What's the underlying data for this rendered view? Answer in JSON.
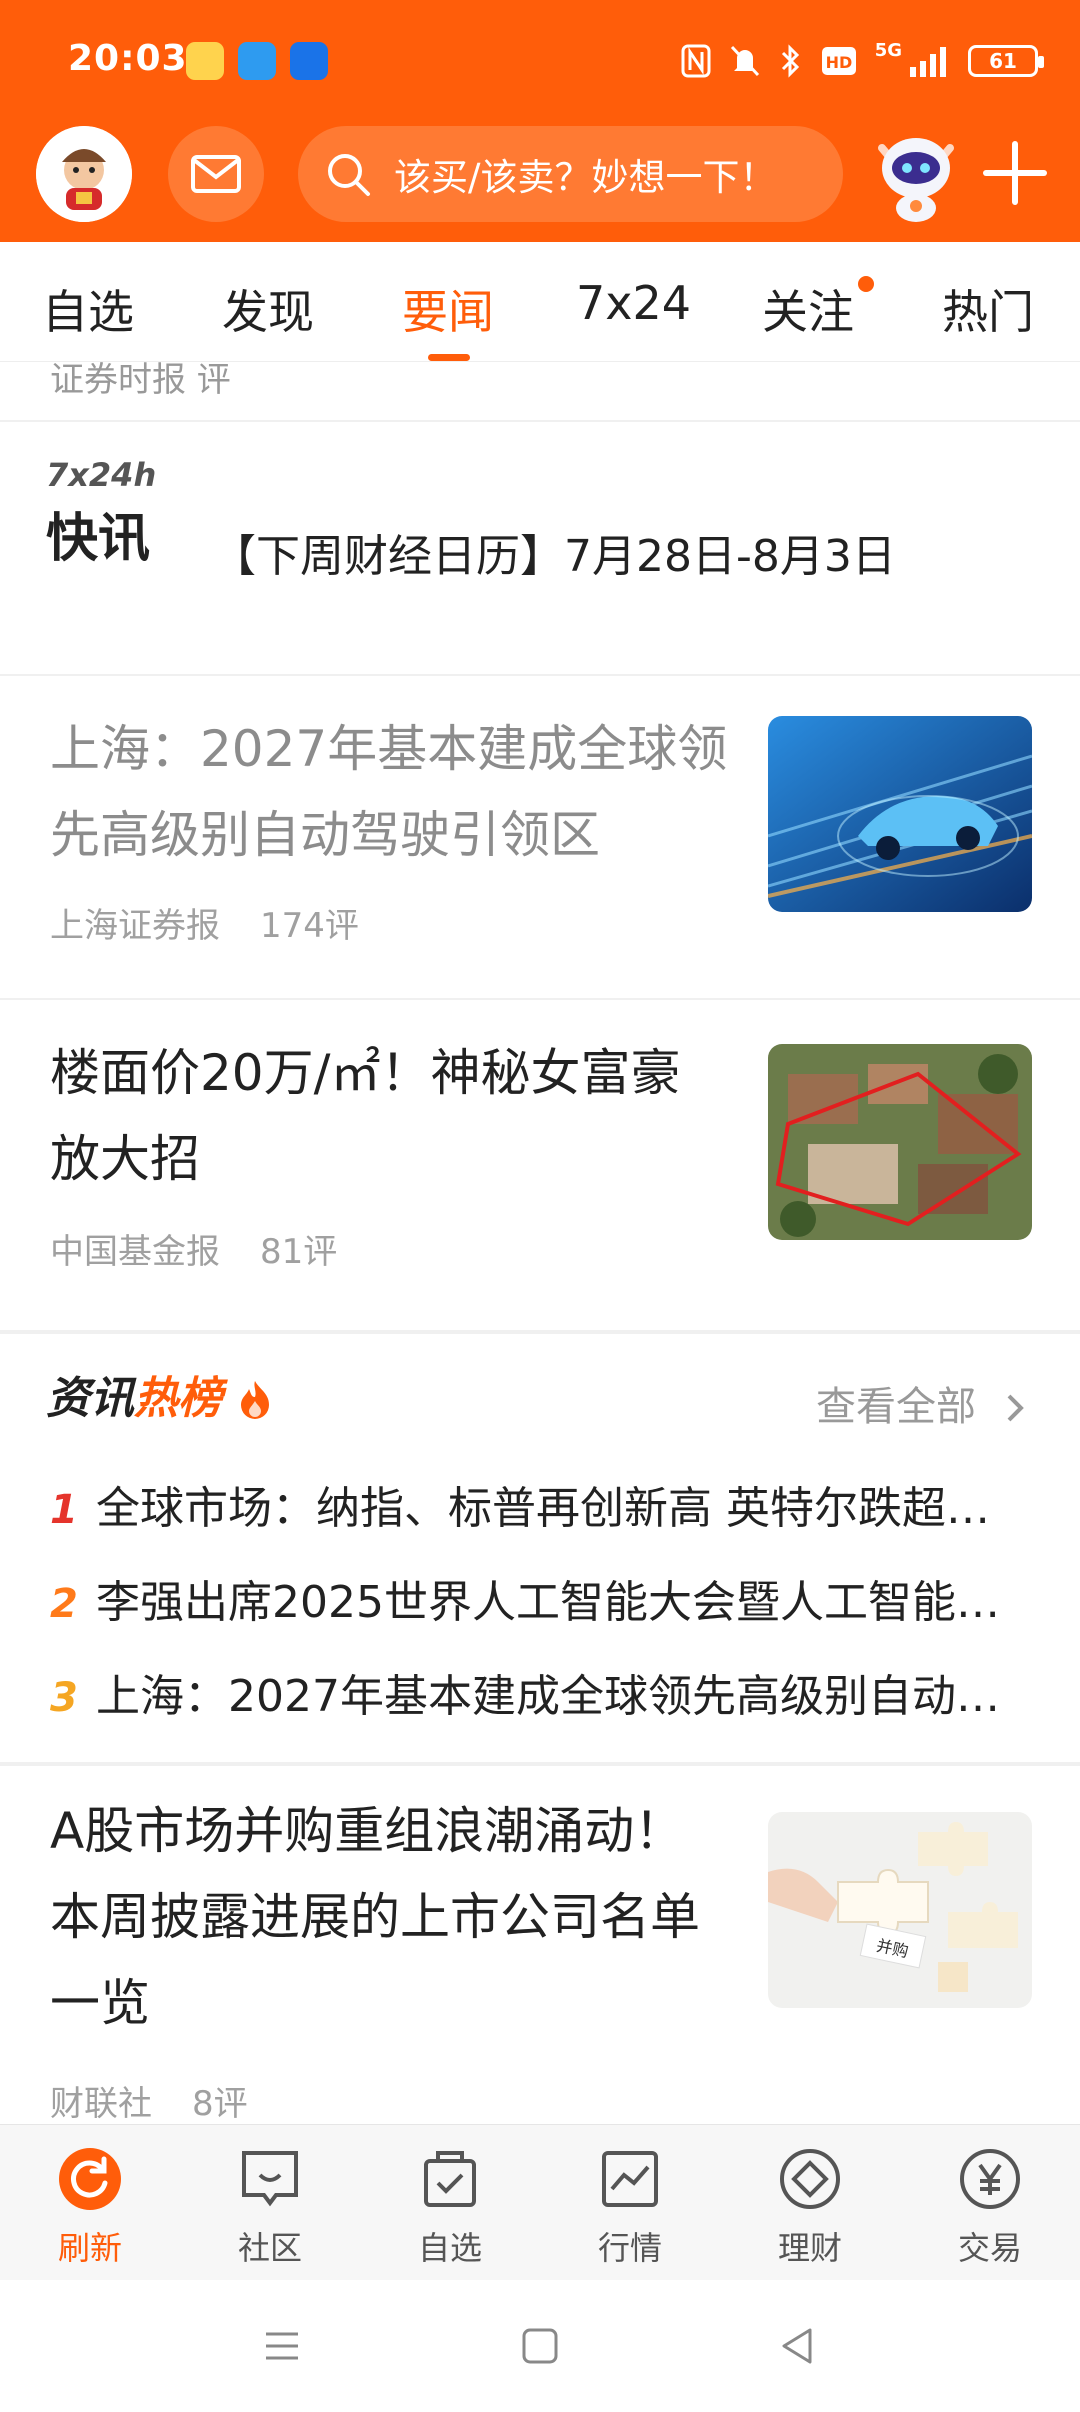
{
  "status_bar": {
    "time": "20:03",
    "network": "5G",
    "battery": "61"
  },
  "header": {
    "search_placeholder": "该买/该卖？妙想一下！"
  },
  "tabs": [
    {
      "label": "自选"
    },
    {
      "label": "发现"
    },
    {
      "label": "要闻"
    },
    {
      "label": "7x24"
    },
    {
      "label": "关注"
    },
    {
      "label": "热门"
    }
  ],
  "feed": {
    "cut_text": "证券时报   评",
    "flash": {
      "logo_top": "7x24h",
      "logo_bottom": "快讯",
      "title": "【下周财经日历】7月28日-8月3日"
    },
    "news": [
      {
        "title": "上海：2027年基本建成全球领先高级别自动驾驶引领区",
        "source": "上海证券报",
        "comments": "174评"
      },
      {
        "title": "楼面价20万/㎡！神秘女富豪放大招",
        "source": "中国基金报",
        "comments": "81评"
      },
      {
        "title": "A股市场并购重组浪潮涌动！本周披露进展的上市公司名单一览",
        "source": "财联社",
        "comments": "8评"
      }
    ],
    "hot": {
      "title_a": "资讯",
      "title_b": "热榜",
      "see_all": "查看全部",
      "items": [
        {
          "rank": "1",
          "text": "全球市场：纳指、标普再创新高 英特尔跌超…"
        },
        {
          "rank": "2",
          "text": "李强出席2025世界人工智能大会暨人工智能…"
        },
        {
          "rank": "3",
          "text": "上海：2027年基本建成全球领先高级别自动…"
        }
      ],
      "colors": {
        "rank1": "#e5342c",
        "rank2": "#ff7a1a",
        "rank3": "#f5a623"
      }
    },
    "thumb_texts": {
      "puzzle": "并购"
    }
  },
  "bottom_nav": [
    {
      "label": "刷新"
    },
    {
      "label": "社区"
    },
    {
      "label": "自选"
    },
    {
      "label": "行情"
    },
    {
      "label": "理财"
    },
    {
      "label": "交易"
    }
  ],
  "colors": {
    "accent": "#ff5d0a"
  }
}
